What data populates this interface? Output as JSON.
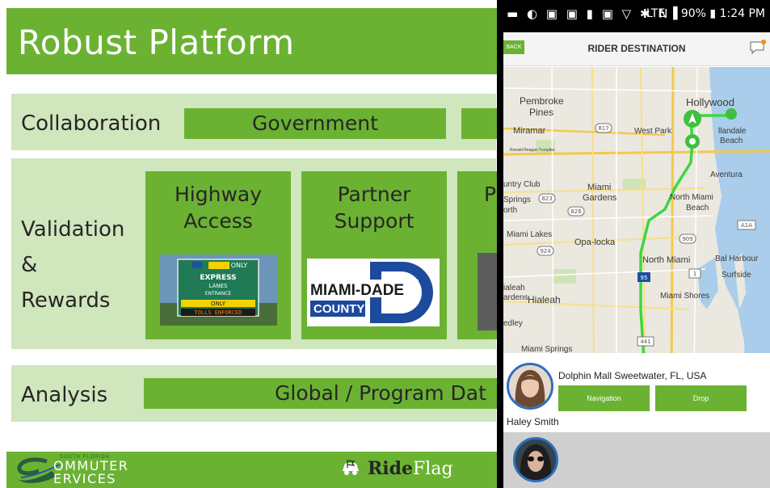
{
  "slide": {
    "title": "Robust Platform",
    "rows": {
      "collaboration": {
        "label": "Collaboration",
        "box1": "Government"
      },
      "validation": {
        "label_lines": [
          "Validation",
          "&",
          "Rewards"
        ],
        "cards": [
          {
            "title_lines": [
              "Highway",
              "Access"
            ]
          },
          {
            "title_lines": [
              "Partner",
              "Support"
            ]
          },
          {
            "title_lines": [
              "P"
            ]
          }
        ],
        "express_sign": {
          "top": "ONLY",
          "l1": "EXPRESS",
          "l2": "LANES",
          "l3": "ENTRANCE",
          "l4": "ONLY",
          "bottom": "TOLLS ENFORCED"
        },
        "miami_logo": {
          "line1": "MIAMI-DADE",
          "line2": "COUNTY"
        }
      },
      "analysis": {
        "label": "Analysis",
        "box1": "Global / Program Dat"
      }
    },
    "footer": {
      "logo_small": "SOUTH FLORIDA",
      "logo_line1": "OMMUTER",
      "logo_line2": "ERVICES",
      "rideflag_ride": "Ride",
      "rideflag_flag": "Flag"
    },
    "colors": {
      "green": "#6bb233",
      "light_green": "#d0e6bd"
    }
  },
  "phone": {
    "status": {
      "left_icons": "▬ ◐ ▣ ▣ ▮ ▣ ▽ ✱ N",
      "right": "LTE ▐ 90% ▮ 1:24 PM"
    },
    "appbar": {
      "back_label": "BACK",
      "title": "RIDER DESTINATION"
    },
    "map_labels": {
      "pembroke": "Pembroke",
      "pines": "Pines",
      "hollywood": "Hollywood",
      "miramar": "Miramar",
      "west_park": "West Park",
      "hallandale": "llandale",
      "beach": "Beach",
      "ronald": "Ronald Reagan Turnpike",
      "aventura": "Aventura",
      "country_club": "untry Club",
      "miami_gardens_1": "Miami",
      "miami_gardens_2": "Gardens",
      "north_miami_beach_1": "North Miami",
      "north_miami_beach_2": "Beach",
      "springs": "Springs",
      "orth": "orth",
      "miami_lakes": "Miami Lakes",
      "opa_locka": "Opa-locka",
      "north_miami": "North Miami",
      "bal_harbour": "Bal Harbour",
      "surfside": "Surfside",
      "ialeah": "ialeah",
      "ardens": "ardens",
      "hialeah": "Hialeah",
      "miami_shores": "Miami Shores",
      "edley": "edley",
      "miami_springs": "Miami Springs",
      "shield_817": "817",
      "shield_823": "823",
      "shield_826": "826",
      "shield_909": "909",
      "shield_924": "924",
      "shield_95": "95",
      "shield_1": "1",
      "shield_a1a": "A1A",
      "shield_441": "441"
    },
    "ride": {
      "destination": "Dolphin Mall Sweetwater, FL, USA",
      "navigation_label": "Navigation",
      "drop_label": "Drop",
      "rider_name": "Haley Smith"
    }
  }
}
